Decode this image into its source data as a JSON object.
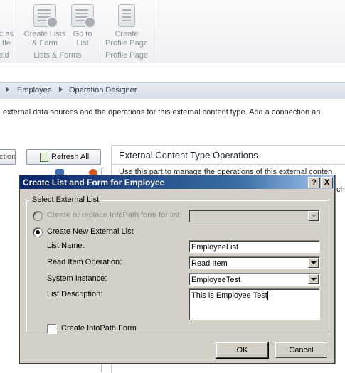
{
  "ribbon": {
    "partial_button_line1": "c as",
    "partial_button_line2": "tle",
    "partial_group_label": "eld",
    "create_lists_form_line1": "Create Lists",
    "create_lists_form_line2": "& Form",
    "go_to_list_line1": "Go to",
    "go_to_list_line2": "List",
    "group_lists_forms": "Lists & Forms",
    "create_profile_page_line1": "Create",
    "create_profile_page_line2": "Profile Page",
    "group_profile_page": "Profile Page"
  },
  "breadcrumb": [
    "Employee",
    "Operation Designer"
  ],
  "description": "external data sources and the operations for this external content type. Add a connection an",
  "toolbar": {
    "partial_button_label": "ction",
    "refresh_all_label": "Refresh All"
  },
  "ect_panel": {
    "title": "External Content Type Operations",
    "description": "Use this part to manage the operations of this external conten",
    "partial_right": "ch"
  },
  "dialog": {
    "title": "Create List and Form for Employee",
    "help_label": "?",
    "close_label": "X",
    "group_label": "Select External List",
    "option_replace_infopath": "Create or replace InfoPath form for list",
    "option_new_list": "Create New External List",
    "list_name_label": "List Name:",
    "list_name_value": "EmployeeList",
    "read_item_label": "Read Item Operation:",
    "read_item_value": "Read Item",
    "system_instance_label": "System Instance:",
    "system_instance_value": "EmployeeTest",
    "list_description_label": "List Description:",
    "list_description_value": "This is Employee Test",
    "create_infopath_label": "Create InfoPath Form",
    "ok_label": "OK",
    "cancel_label": "Cancel"
  }
}
